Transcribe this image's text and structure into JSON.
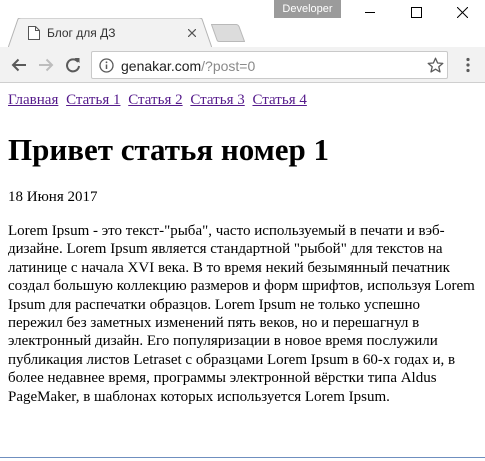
{
  "window": {
    "profile_badge": "Developer"
  },
  "tab": {
    "title": "Блог для ДЗ"
  },
  "address_bar": {
    "host": "genakar.com",
    "path": "/?post=0"
  },
  "page": {
    "nav_links": [
      "Главная",
      "Статья 1",
      "Статья 2",
      "Статья 3",
      "Статья 4"
    ],
    "title": "Привет статья номер 1",
    "date": "18 Июня 2017",
    "body": "Lorem Ipsum - это текст-\"рыба\", часто используемый в печати и вэб-дизайне. Lorem Ipsum является стандартной \"рыбой\" для текстов на латинице с начала XVI века. В то время некий безымянный печатник создал большую коллекцию размеров и форм шрифтов, используя Lorem Ipsum для распечатки образцов. Lorem Ipsum не только успешно пережил без заметных изменений пять веков, но и перешагнул в электронный дизайн. Его популяризации в новое время послужили публикация листов Letraset с образцами Lorem Ipsum в 60-х годах и, в более недавнее время, программы электронной вёрстки типа Aldus PageMaker, в шаблонах которых используется Lorem Ipsum."
  },
  "colors": {
    "visited_link": "#551a8b",
    "toolbar_bg": "#f2f2f2",
    "profile_badge_bg": "#9b9b9b"
  },
  "icons": {
    "tab": "page-icon",
    "back": "arrow-left-icon",
    "forward": "arrow-right-icon",
    "reload": "reload-icon",
    "site_info": "info-icon",
    "bookmark": "star-icon",
    "menu": "kebab-menu-icon"
  }
}
